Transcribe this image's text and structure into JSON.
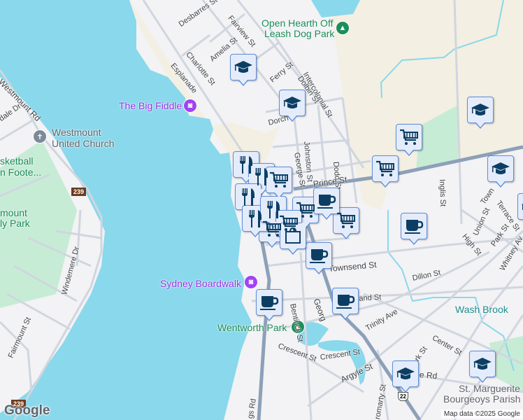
{
  "map": {
    "colors": {
      "water": "#8ad8ec",
      "land": "#f3f2f4",
      "park": "#c6ecd5",
      "sand": "#f3efe2",
      "road": "#d0d6df",
      "highway": "#8ca0b8",
      "marker_fill": "#e4ecfb",
      "marker_border": "#5f8fd8",
      "icon": "#0c3e63"
    },
    "places": {
      "big_fiddle": "The Big Fiddle",
      "westmount_church": "Westmount\nUnited Church",
      "westmount_church_l1": "Westmount",
      "westmount_church_l2": "United Church",
      "basketball_l1": "sketball",
      "basketball_l2": "n Foote...",
      "westmount_park_l1": "mount",
      "westmount_park_l2": "ly Park",
      "dog_park_l1": "Open Hearth Off",
      "dog_park_l2": "Leash Dog Park",
      "boardwalk": "Sydney Boardwalk",
      "wentworth": "Wentworth Park",
      "wash_brook": "Wash Brook",
      "parish_l1": "St. Marguerite",
      "parish_l2": "Bourgeoys Parish"
    },
    "streets": {
      "desbarres": "Desbarres St",
      "fairview": "Fairview St",
      "charlotte": "Charlotte St",
      "amelia": "Amelia St",
      "esplanade": "Esplanade",
      "ferry": "Ferry St",
      "dolbin": "Dolbin St",
      "intercolonial": "Intercolonial St",
      "dorchester": "Dorch",
      "johnston": "Johnston St",
      "dodd": "Dodd St",
      "george": "George St",
      "prince": "Prince St",
      "inglis": "Inglis St",
      "townsend": "Townsend St",
      "bentinck": "Bentinck St",
      "george2": "Georg",
      "dillon": "Dillon St",
      "island": "land St",
      "trinity": "Trinity Ave",
      "center": "Center St",
      "crescent1": "Crescent St",
      "crescent2": "Crescent St",
      "argyle": "Argyle St",
      "park": "Park St",
      "cromarty": "romarty St",
      "union": "Union St",
      "high": "High St",
      "park2": "Park St",
      "whitney": "Whitney Av",
      "terrace": "Terrace St",
      "town": "Town",
      "westmount_rd": "Westmount Rd",
      "windemere": "Windemere Dr",
      "fairmount": "Fairmount St",
      "kings": "gs Rd",
      "dale": "dale Dr",
      "rd": "e Rd"
    },
    "shields": {
      "route239_a": "239",
      "route239_b": "239",
      "us22": "22"
    },
    "markers": [
      "school",
      "school",
      "school",
      "school",
      "school",
      "school",
      "school",
      "cart",
      "cart",
      "cart",
      "cart",
      "cart",
      "cup",
      "cup",
      "cup",
      "cup",
      "cup",
      "restaurant",
      "restaurant",
      "restaurant",
      "restaurant",
      "cart",
      "restaurant",
      "cart",
      "store"
    ],
    "attribution": "Map data ©2025 Google",
    "logo": "Google"
  }
}
